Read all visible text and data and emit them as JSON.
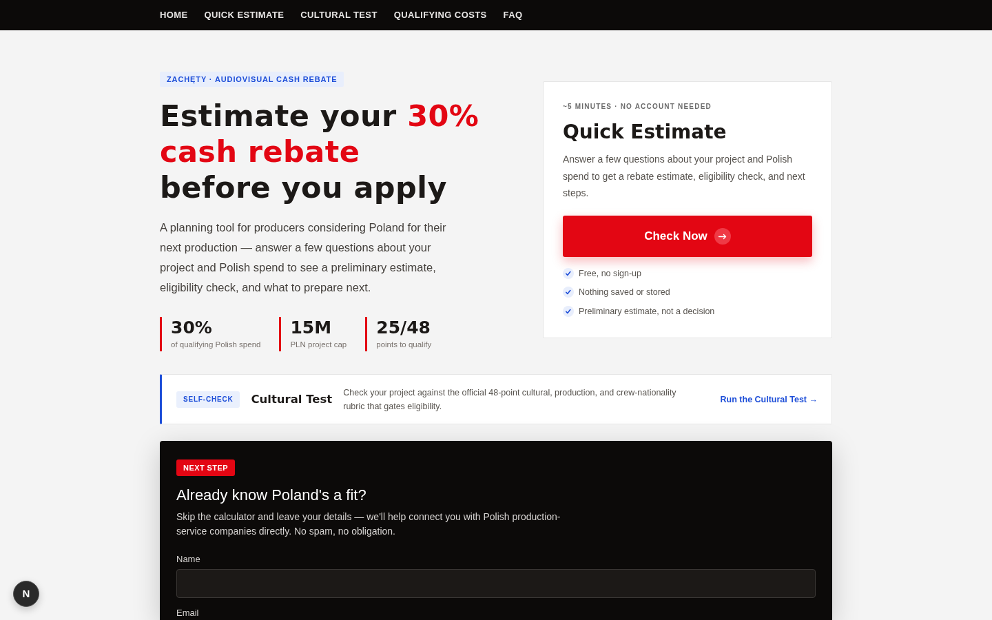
{
  "nav": {
    "items": [
      {
        "label": "HOME"
      },
      {
        "label": "QUICK ESTIMATE"
      },
      {
        "label": "CULTURAL TEST"
      },
      {
        "label": "QUALIFYING COSTS"
      },
      {
        "label": "FAQ"
      }
    ]
  },
  "hero": {
    "eyebrow": "ZACHĘTY · AUDIOVISUAL CASH REBATE",
    "headline": {
      "lead": "Estimate your",
      "highlight": "30% cash rebate",
      "tail": "before you apply"
    },
    "intro": "A planning tool for producers considering Poland for their next production — answer a few questions about your project and Polish spend to see a preliminary estimate, eligibility check, and what to prepare next.",
    "stats": [
      {
        "value": "30%",
        "label": "of qualifying Polish spend"
      },
      {
        "value": "15M",
        "label": "PLN project cap"
      },
      {
        "value": "25/48",
        "label": "points to qualify"
      }
    ]
  },
  "estimate_card": {
    "eyebrow": "~5 MINUTES · NO ACCOUNT NEEDED",
    "title": "Quick Estimate",
    "description": "Answer a few questions about your project and Polish spend to get a rebate estimate, eligibility check, and next steps.",
    "button": {
      "label": "Check Now"
    },
    "checklist": [
      "Free, no sign-up",
      "Nothing saved or stored",
      "Preliminary estimate, not a decision"
    ]
  },
  "cultural_test": {
    "badge": "SELF-CHECK",
    "title": "Cultural Test",
    "description": "Check your project against the official 48-point cultural, production, and crew-nationality rubric that gates eligibility.",
    "link": "Run the Cultural Test →"
  },
  "contact_panel": {
    "badge": "NEXT STEP",
    "title": "Already know Poland's a fit?",
    "description": "Skip the calculator and leave your details — we'll help connect you with Polish production-service companies directly. No spam, no obligation.",
    "fields": [
      {
        "kind": "field",
        "label": "Name"
      },
      {
        "kind": "label",
        "label": "Email"
      }
    ]
  },
  "dev_badge": {
    "label": "N"
  }
}
